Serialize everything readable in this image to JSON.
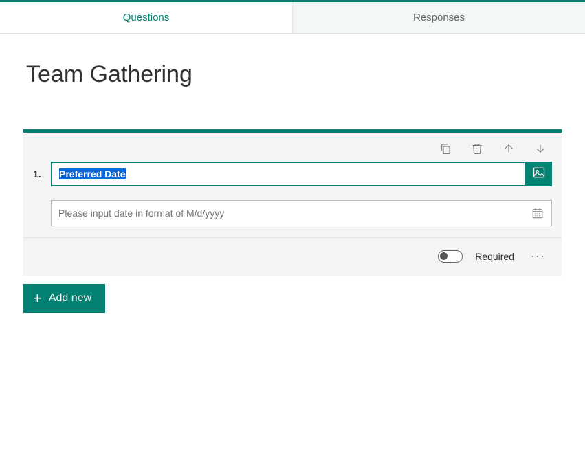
{
  "tabs": {
    "questions": "Questions",
    "responses": "Responses"
  },
  "form": {
    "title": "Team Gathering"
  },
  "question": {
    "number": "1.",
    "title": "Preferred Date",
    "date_placeholder": "Please input date in format of M/d/yyyy"
  },
  "footer": {
    "required_label": "Required"
  },
  "buttons": {
    "add_new": "Add new"
  }
}
